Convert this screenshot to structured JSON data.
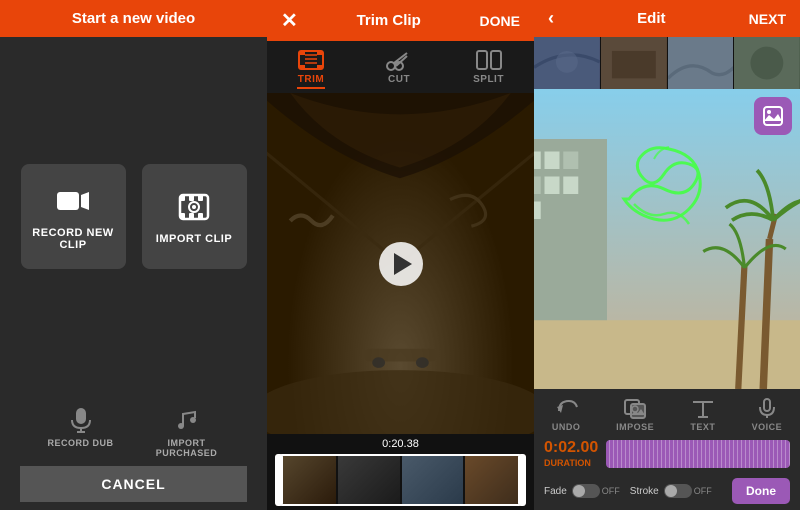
{
  "panel1": {
    "header": "Start a new video",
    "record_btn_label": "RECORD NEW CLIP",
    "import_btn_label": "IMPORT CLIP",
    "record_dub_label": "RECORD DUB",
    "import_purchased_label": "IMPORT PURCHASED",
    "cancel_label": "CANCEL"
  },
  "panel2": {
    "header": "Trim Clip",
    "done_label": "DONE",
    "toolbar": {
      "trim_label": "TRIM",
      "cut_label": "CUT",
      "split_label": "SPLIT"
    },
    "timeline_time": "0:20.38"
  },
  "panel3": {
    "header": "Edit",
    "next_label": "NEXT",
    "toolbar": {
      "undo_label": "UNDO",
      "impose_label": "IMPOSE",
      "text_label": "TEXT",
      "voice_label": "VOICE"
    },
    "duration_time": "0:02.00",
    "duration_label": "DURATION",
    "fade_label": "Fade",
    "fade_state": "OFF",
    "stroke_label": "Stroke",
    "stroke_state": "OFF",
    "done_btn_label": "Done"
  }
}
